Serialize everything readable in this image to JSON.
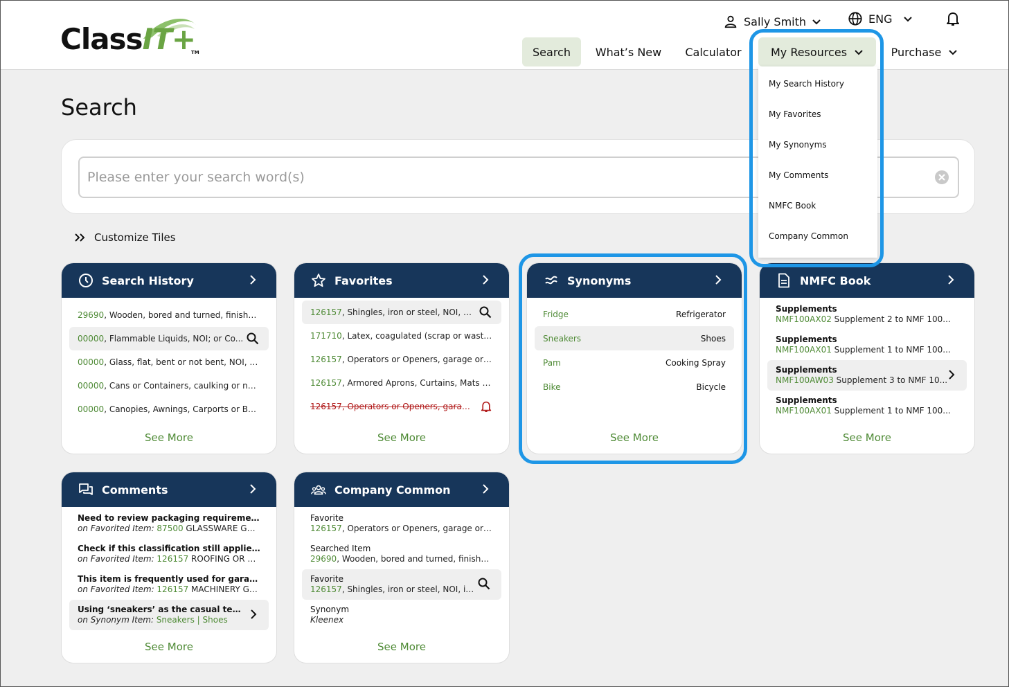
{
  "brand": {
    "logo_main": "Class",
    "logo_accent": "IT+",
    "logo_tm": "TM"
  },
  "header": {
    "user_name": "Sally Smith",
    "language": "ENG"
  },
  "nav": {
    "search": "Search",
    "whats_new": "What’s New",
    "calculator": "Calculator",
    "my_resources": "My Resources",
    "purchase": "Purchase"
  },
  "dropdown": {
    "items": [
      "My Search History",
      "My Favorites",
      "My Synonyms",
      "My Comments",
      "NMFC Book",
      "Company Common"
    ]
  },
  "page": {
    "title": "Search",
    "search_placeholder": "Please enter your search word(s)",
    "customize_label": "Customize Tiles"
  },
  "see_more": "See More",
  "tiles": {
    "search_history": {
      "title": "Search History",
      "rows": [
        {
          "code": "29690",
          "desc": ", Wooden, bored and turned, finished..."
        },
        {
          "code": "00000",
          "desc": ", Flammable Liquids, NOI; or Co..."
        },
        {
          "code": "00000",
          "desc": ", Glass, flat, bent or not bent, NOI, se..."
        },
        {
          "code": "00000",
          "desc": ", Cans or Containers, caulking or not..."
        },
        {
          "code": "00000",
          "desc": ", Canopies, Awnings, Carports or Bo..."
        }
      ]
    },
    "favorites": {
      "title": "Favorites",
      "rows": [
        {
          "code": "126157",
          "desc": ", Shingles, iron or steel, NOI, in bo..."
        },
        {
          "code": "171710",
          "desc": ", Latex, coagulated (scrap or waste lat..."
        },
        {
          "code": "126157",
          "desc": ", Operators or Openers, garage or co..."
        },
        {
          "code": "126157",
          "desc": ", Armored Aprons, Curtains, Mats or V..."
        },
        {
          "code": "126157",
          "desc": ", Operators or Openers, garage or..."
        }
      ]
    },
    "synonyms": {
      "title": "Synonyms",
      "rows": [
        {
          "term": "Fridge",
          "value": "Refrigerator"
        },
        {
          "term": "Sneakers",
          "value": "Shoes"
        },
        {
          "term": "Pam",
          "value": "Cooking Spray"
        },
        {
          "term": "Bike",
          "value": "Bicycle"
        }
      ]
    },
    "nmfc": {
      "title": "NMFC Book",
      "rows": [
        {
          "label": "Supplements",
          "code": "NMF100AX02",
          "desc": " Supplement 2 to NMF 100..."
        },
        {
          "label": "Supplements",
          "code": "NMF100AX01",
          "desc": " Supplement 1 to NMF 100..."
        },
        {
          "label": "Supplements",
          "code": "NMF100AW03",
          "desc": " Supplement 3 to NMF 10..."
        },
        {
          "label": "Supplements",
          "code": "NMF100AX01",
          "desc": " Supplement 1 to NMF 100..."
        }
      ]
    },
    "comments": {
      "title": "Comments",
      "rows": [
        {
          "text": "Need to review packaging requirements f...",
          "prefix": "on Favorited Item: ",
          "code": "87500",
          "desc": " GLASSWARE GRO..."
        },
        {
          "text": "Check if this classification still applies for ...",
          "prefix": "on Favorited Item: ",
          "code": "126157",
          "desc": " ROOFING OR SIDI..."
        },
        {
          "text": "This item is frequently used for garage do...",
          "prefix": "on Favorited Item: ",
          "code": "126157",
          "desc": " MACHINERY GRO..."
        },
        {
          "text": "Using ‘sneakers’ as the casual term fo...",
          "prefix": "on Synonym Item: ",
          "code": "Sneakers | Shoes",
          "desc": ""
        }
      ]
    },
    "company_common": {
      "title": "Company Common",
      "rows": [
        {
          "label": "Favorite",
          "code": "126157",
          "desc": ", Operators or Openers, garage or co..."
        },
        {
          "label": "Searched Item",
          "code": "29690",
          "desc": ", Wooden, bored and turned, finished..."
        },
        {
          "label": "Favorite",
          "code": "126157",
          "desc": ", Shingles, iron or steel, NOI, in b..."
        },
        {
          "label": "Synonym",
          "code": "",
          "desc": "Kleenex"
        }
      ]
    }
  },
  "colors": {
    "navy": "#17365a",
    "green": "#4e8a35",
    "highlight": "#1e96e6",
    "alert_red": "#b01818"
  }
}
